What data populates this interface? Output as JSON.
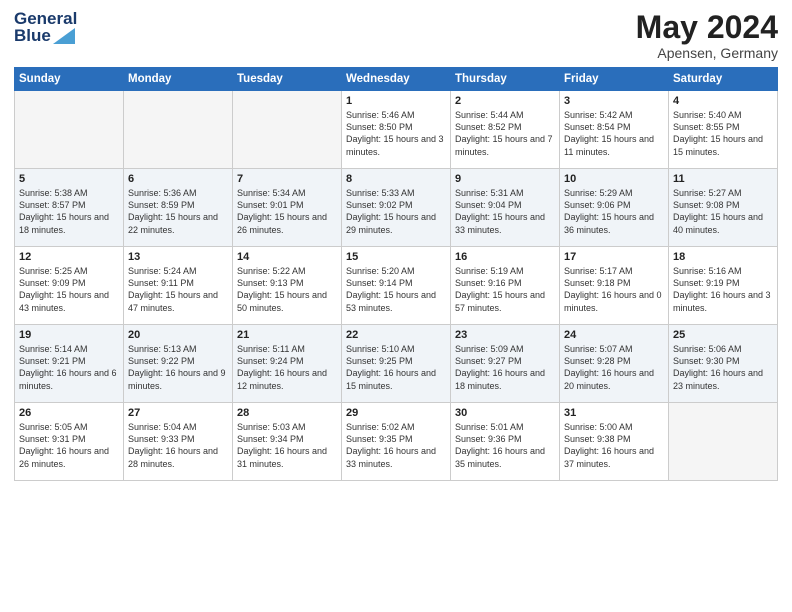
{
  "header": {
    "logo_line1": "General",
    "logo_line2": "Blue",
    "month": "May 2024",
    "location": "Apensen, Germany"
  },
  "weekdays": [
    "Sunday",
    "Monday",
    "Tuesday",
    "Wednesday",
    "Thursday",
    "Friday",
    "Saturday"
  ],
  "weeks": [
    [
      {
        "day": "",
        "sunrise": "",
        "sunset": "",
        "daylight": ""
      },
      {
        "day": "",
        "sunrise": "",
        "sunset": "",
        "daylight": ""
      },
      {
        "day": "",
        "sunrise": "",
        "sunset": "",
        "daylight": ""
      },
      {
        "day": "1",
        "sunrise": "Sunrise: 5:46 AM",
        "sunset": "Sunset: 8:50 PM",
        "daylight": "Daylight: 15 hours and 3 minutes."
      },
      {
        "day": "2",
        "sunrise": "Sunrise: 5:44 AM",
        "sunset": "Sunset: 8:52 PM",
        "daylight": "Daylight: 15 hours and 7 minutes."
      },
      {
        "day": "3",
        "sunrise": "Sunrise: 5:42 AM",
        "sunset": "Sunset: 8:54 PM",
        "daylight": "Daylight: 15 hours and 11 minutes."
      },
      {
        "day": "4",
        "sunrise": "Sunrise: 5:40 AM",
        "sunset": "Sunset: 8:55 PM",
        "daylight": "Daylight: 15 hours and 15 minutes."
      }
    ],
    [
      {
        "day": "5",
        "sunrise": "Sunrise: 5:38 AM",
        "sunset": "Sunset: 8:57 PM",
        "daylight": "Daylight: 15 hours and 18 minutes."
      },
      {
        "day": "6",
        "sunrise": "Sunrise: 5:36 AM",
        "sunset": "Sunset: 8:59 PM",
        "daylight": "Daylight: 15 hours and 22 minutes."
      },
      {
        "day": "7",
        "sunrise": "Sunrise: 5:34 AM",
        "sunset": "Sunset: 9:01 PM",
        "daylight": "Daylight: 15 hours and 26 minutes."
      },
      {
        "day": "8",
        "sunrise": "Sunrise: 5:33 AM",
        "sunset": "Sunset: 9:02 PM",
        "daylight": "Daylight: 15 hours and 29 minutes."
      },
      {
        "day": "9",
        "sunrise": "Sunrise: 5:31 AM",
        "sunset": "Sunset: 9:04 PM",
        "daylight": "Daylight: 15 hours and 33 minutes."
      },
      {
        "day": "10",
        "sunrise": "Sunrise: 5:29 AM",
        "sunset": "Sunset: 9:06 PM",
        "daylight": "Daylight: 15 hours and 36 minutes."
      },
      {
        "day": "11",
        "sunrise": "Sunrise: 5:27 AM",
        "sunset": "Sunset: 9:08 PM",
        "daylight": "Daylight: 15 hours and 40 minutes."
      }
    ],
    [
      {
        "day": "12",
        "sunrise": "Sunrise: 5:25 AM",
        "sunset": "Sunset: 9:09 PM",
        "daylight": "Daylight: 15 hours and 43 minutes."
      },
      {
        "day": "13",
        "sunrise": "Sunrise: 5:24 AM",
        "sunset": "Sunset: 9:11 PM",
        "daylight": "Daylight: 15 hours and 47 minutes."
      },
      {
        "day": "14",
        "sunrise": "Sunrise: 5:22 AM",
        "sunset": "Sunset: 9:13 PM",
        "daylight": "Daylight: 15 hours and 50 minutes."
      },
      {
        "day": "15",
        "sunrise": "Sunrise: 5:20 AM",
        "sunset": "Sunset: 9:14 PM",
        "daylight": "Daylight: 15 hours and 53 minutes."
      },
      {
        "day": "16",
        "sunrise": "Sunrise: 5:19 AM",
        "sunset": "Sunset: 9:16 PM",
        "daylight": "Daylight: 15 hours and 57 minutes."
      },
      {
        "day": "17",
        "sunrise": "Sunrise: 5:17 AM",
        "sunset": "Sunset: 9:18 PM",
        "daylight": "Daylight: 16 hours and 0 minutes."
      },
      {
        "day": "18",
        "sunrise": "Sunrise: 5:16 AM",
        "sunset": "Sunset: 9:19 PM",
        "daylight": "Daylight: 16 hours and 3 minutes."
      }
    ],
    [
      {
        "day": "19",
        "sunrise": "Sunrise: 5:14 AM",
        "sunset": "Sunset: 9:21 PM",
        "daylight": "Daylight: 16 hours and 6 minutes."
      },
      {
        "day": "20",
        "sunrise": "Sunrise: 5:13 AM",
        "sunset": "Sunset: 9:22 PM",
        "daylight": "Daylight: 16 hours and 9 minutes."
      },
      {
        "day": "21",
        "sunrise": "Sunrise: 5:11 AM",
        "sunset": "Sunset: 9:24 PM",
        "daylight": "Daylight: 16 hours and 12 minutes."
      },
      {
        "day": "22",
        "sunrise": "Sunrise: 5:10 AM",
        "sunset": "Sunset: 9:25 PM",
        "daylight": "Daylight: 16 hours and 15 minutes."
      },
      {
        "day": "23",
        "sunrise": "Sunrise: 5:09 AM",
        "sunset": "Sunset: 9:27 PM",
        "daylight": "Daylight: 16 hours and 18 minutes."
      },
      {
        "day": "24",
        "sunrise": "Sunrise: 5:07 AM",
        "sunset": "Sunset: 9:28 PM",
        "daylight": "Daylight: 16 hours and 20 minutes."
      },
      {
        "day": "25",
        "sunrise": "Sunrise: 5:06 AM",
        "sunset": "Sunset: 9:30 PM",
        "daylight": "Daylight: 16 hours and 23 minutes."
      }
    ],
    [
      {
        "day": "26",
        "sunrise": "Sunrise: 5:05 AM",
        "sunset": "Sunset: 9:31 PM",
        "daylight": "Daylight: 16 hours and 26 minutes."
      },
      {
        "day": "27",
        "sunrise": "Sunrise: 5:04 AM",
        "sunset": "Sunset: 9:33 PM",
        "daylight": "Daylight: 16 hours and 28 minutes."
      },
      {
        "day": "28",
        "sunrise": "Sunrise: 5:03 AM",
        "sunset": "Sunset: 9:34 PM",
        "daylight": "Daylight: 16 hours and 31 minutes."
      },
      {
        "day": "29",
        "sunrise": "Sunrise: 5:02 AM",
        "sunset": "Sunset: 9:35 PM",
        "daylight": "Daylight: 16 hours and 33 minutes."
      },
      {
        "day": "30",
        "sunrise": "Sunrise: 5:01 AM",
        "sunset": "Sunset: 9:36 PM",
        "daylight": "Daylight: 16 hours and 35 minutes."
      },
      {
        "day": "31",
        "sunrise": "Sunrise: 5:00 AM",
        "sunset": "Sunset: 9:38 PM",
        "daylight": "Daylight: 16 hours and 37 minutes."
      },
      {
        "day": "",
        "sunrise": "",
        "sunset": "",
        "daylight": ""
      }
    ]
  ]
}
